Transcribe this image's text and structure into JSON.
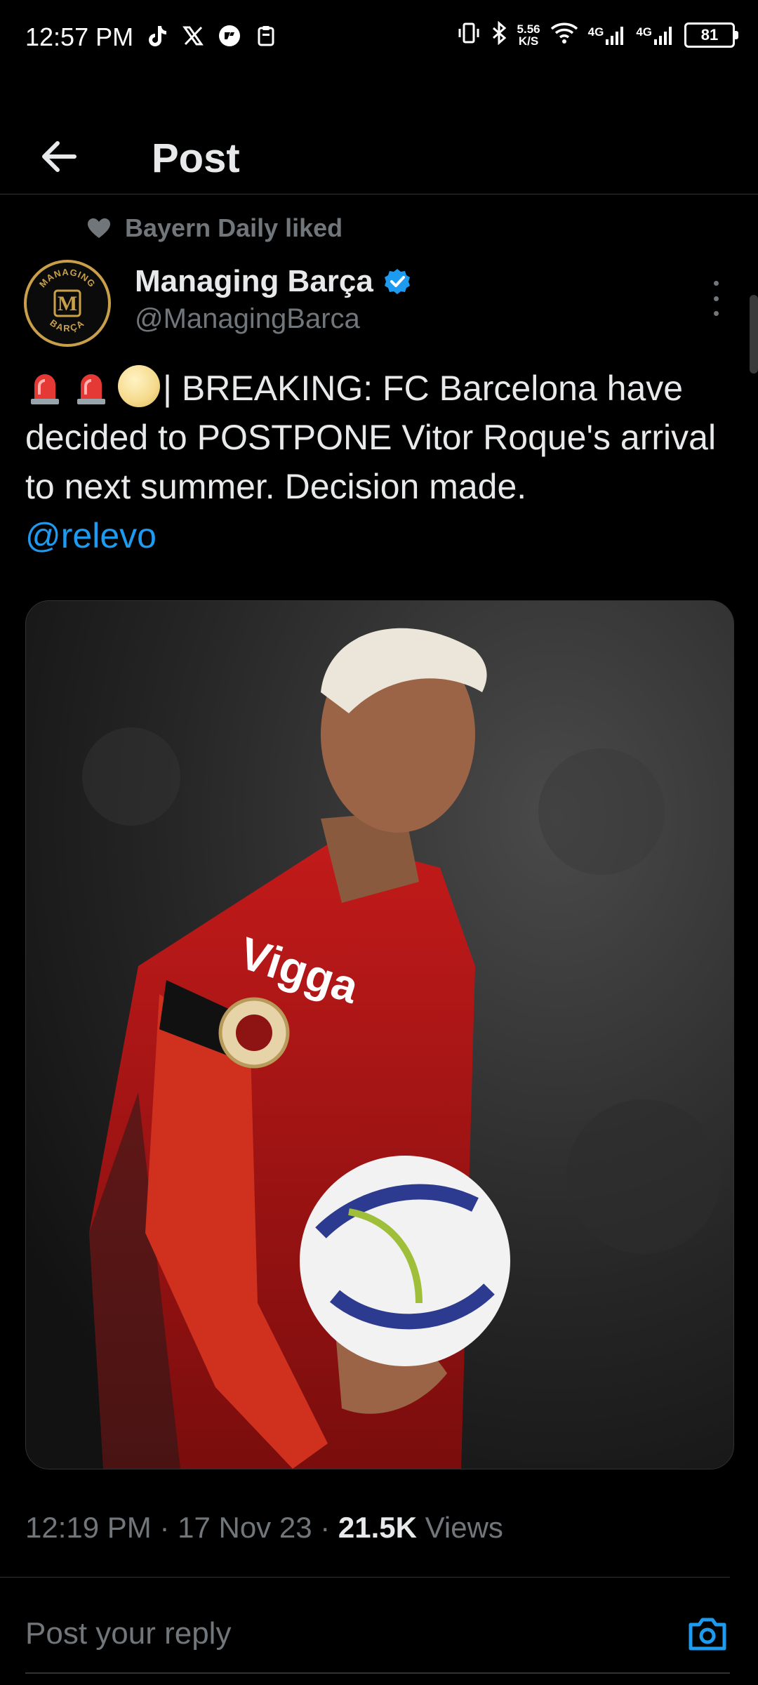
{
  "status_bar": {
    "time": "12:57 PM",
    "left_icons": [
      "tiktok-icon",
      "x-icon",
      "app-icon",
      "clipboard-icon"
    ],
    "net_speed_value": "5.56",
    "net_speed_unit": "K/S",
    "signal_1": "4G",
    "signal_2": "4G",
    "battery": "81"
  },
  "header": {
    "title": "Post"
  },
  "social_context": {
    "text": "Bayern Daily liked"
  },
  "author": {
    "name": "Managing Barça",
    "handle": "@ManagingBarca",
    "verified": true,
    "avatar_top_text": "MANAGING",
    "avatar_letter": "M",
    "avatar_bottom_text": "BARÇA"
  },
  "tweet": {
    "text": "| BREAKING: FC Barcelona have decided to POSTPONE Vitor Roque's arrival to next summer. Decision made.",
    "mention": "@relevo",
    "emojis": [
      "siren-emoji",
      "siren-emoji",
      "moon-emoji"
    ]
  },
  "media": {
    "shirt_sponsor": "Vigga",
    "description_icon": "player-photo"
  },
  "meta": {
    "time": "12:19 PM",
    "separator": " · ",
    "date": "17 Nov 23",
    "views_count": "21.5K",
    "views_label": "Views"
  },
  "reply": {
    "placeholder": "Post your reply"
  },
  "colors": {
    "background": "#000000",
    "text_primary": "#e7e9ea",
    "text_secondary": "#71767b",
    "accent": "#1d9bf0",
    "divider": "#2f3336"
  }
}
